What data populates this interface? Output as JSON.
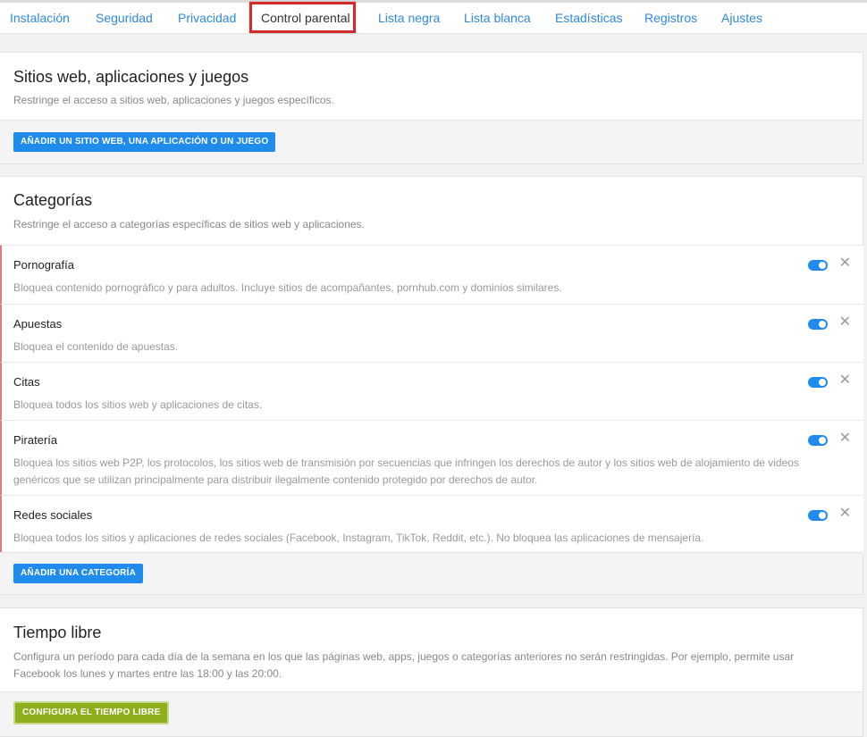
{
  "nav": {
    "tabs": [
      {
        "label": "Instalación"
      },
      {
        "label": "Seguridad"
      },
      {
        "label": "Privacidad"
      },
      {
        "label": "Control parental"
      },
      {
        "label": "Lista negra"
      },
      {
        "label": "Lista blanca"
      },
      {
        "label": "Estadísticas"
      },
      {
        "label": "Registros"
      },
      {
        "label": "Ajustes"
      }
    ],
    "active": "Control parental"
  },
  "sites": {
    "title": "Sitios web, aplicaciones y juegos",
    "description": "Restringe el acceso a sitios web, aplicaciones y juegos específicos.",
    "add_button": "AÑADIR UN SITIO WEB, UNA APLICACIÓN O UN JUEGO"
  },
  "categories": {
    "title": "Categorías",
    "description": "Restringe el acceso a categorías específicas de sitios web y aplicaciones.",
    "items": [
      {
        "name": "Pornografía",
        "description": "Bloquea contenido pornográfico y para adultos. Incluye sitios de acompañantes, pornhub.com y dominios similares.",
        "enabled": true
      },
      {
        "name": "Apuestas",
        "description": "Bloquea el contenido de apuestas.",
        "enabled": true
      },
      {
        "name": "Citas",
        "description": "Bloquea todos los sitios web y aplicaciones de citas.",
        "enabled": true
      },
      {
        "name": "Piratería",
        "description": "Bloquea los sitios web P2P, los protocolos, los sitios web de transmisión por secuencias que infringen los derechos de autor y los sitios web de alojamiento de videos genéricos que se utilizan principalmente para distribuir ilegalmente contenido protegido por derechos de autor.",
        "enabled": true
      },
      {
        "name": "Redes sociales",
        "description": "Bloquea todos los sitios y aplicaciones de redes sociales (Facebook, Instagram, TikTok, Reddit, etc.). No bloquea las aplicaciones de mensajería.",
        "enabled": true
      }
    ],
    "remove_symbol": "✕",
    "add_button": "AÑADIR UNA CATEGORÍA"
  },
  "free_time": {
    "title": "Tiempo libre",
    "description": "Configura un período para cada día de la semana en los que las páginas web, apps, juegos o categorías anteriores no serán restringidas. Por ejemplo, permite usar Facebook los lunes y martes entre las 18:00 y las 20:00.",
    "button": "CONFIGURA EL TIEMPO LIBRE"
  },
  "colors": {
    "accent": "#1f8ced",
    "highlight": "#d32a2a",
    "free_time_button": "#8fae1c"
  }
}
